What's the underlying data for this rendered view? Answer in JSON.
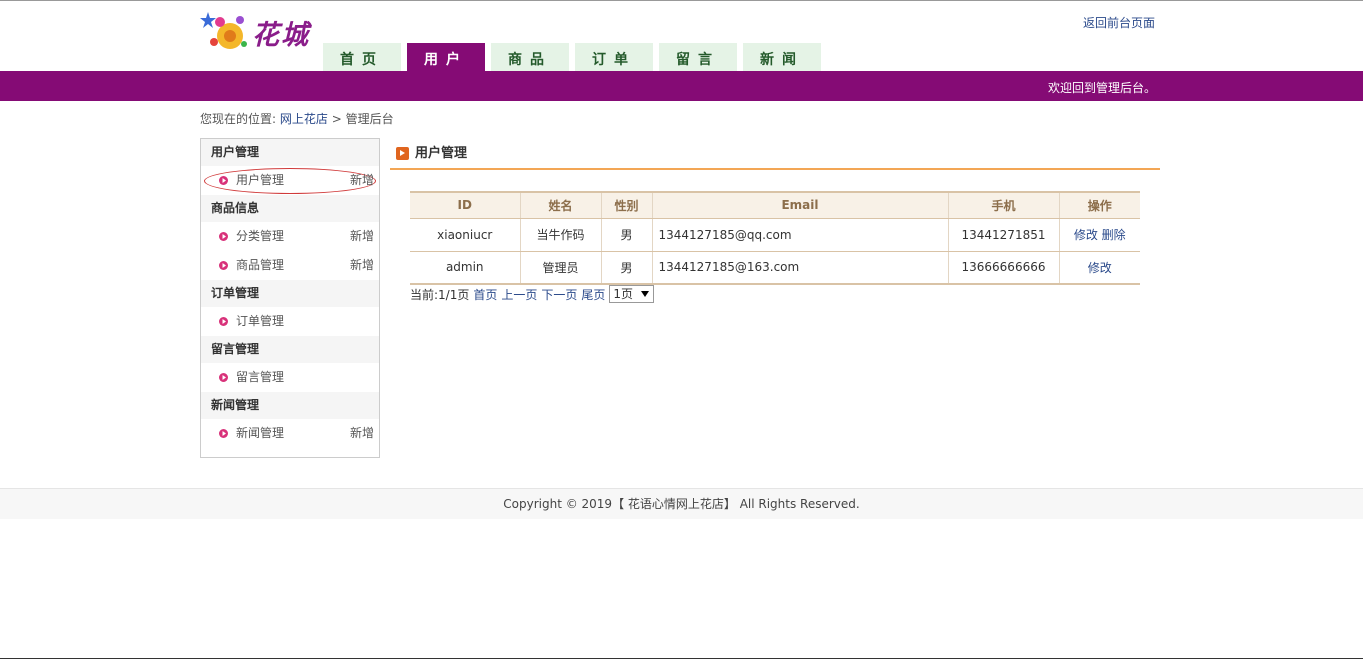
{
  "header": {
    "logo_text": "花城",
    "back_link": "返回前台页面",
    "welcome": "欢迎回到管理后台。",
    "nav": [
      {
        "label": "首页",
        "active": false
      },
      {
        "label": "用户",
        "active": true
      },
      {
        "label": "商品",
        "active": false
      },
      {
        "label": "订单",
        "active": false
      },
      {
        "label": "留言",
        "active": false
      },
      {
        "label": "新闻",
        "active": false
      }
    ]
  },
  "breadcrumb": {
    "prefix": "您现在的位置:",
    "home": "网上花店",
    "separator": ">",
    "current": "管理后台"
  },
  "sidebar": {
    "groups": [
      {
        "title": "用户管理",
        "items": [
          {
            "label": "用户管理",
            "add": "新增"
          }
        ]
      },
      {
        "title": "商品信息",
        "items": [
          {
            "label": "分类管理",
            "add": "新增"
          },
          {
            "label": "商品管理",
            "add": "新增"
          }
        ]
      },
      {
        "title": "订单管理",
        "items": [
          {
            "label": "订单管理",
            "add": ""
          }
        ]
      },
      {
        "title": "留言管理",
        "items": [
          {
            "label": "留言管理",
            "add": ""
          }
        ]
      },
      {
        "title": "新闻管理",
        "items": [
          {
            "label": "新闻管理",
            "add": "新增"
          }
        ]
      }
    ]
  },
  "main": {
    "title": "用户管理",
    "table": {
      "headers": [
        "ID",
        "姓名",
        "性别",
        "Email",
        "手机",
        "操作"
      ],
      "rows": [
        {
          "id": "xiaoniucr",
          "name": "当牛作码",
          "gender": "男",
          "email": "1344127185@qq.com",
          "phone": "13441271851",
          "actions": [
            "修改",
            "删除"
          ]
        },
        {
          "id": "admin",
          "name": "管理员",
          "gender": "男",
          "email": "1344127185@163.com",
          "phone": "13666666666",
          "actions": [
            "修改"
          ]
        }
      ]
    },
    "pager": {
      "current": "当前:1/1页",
      "first": "首页",
      "prev": "上一页",
      "next": "下一页",
      "last": "尾页",
      "select_value": "1页"
    }
  },
  "footer": {
    "text": "Copyright © 2019【 花语心情网上花店】 All Rights Reserved."
  },
  "colors": {
    "brand_purple": "#850b75",
    "nav_tab_bg": "#e5f3e6",
    "title_underline": "#f3a655"
  }
}
